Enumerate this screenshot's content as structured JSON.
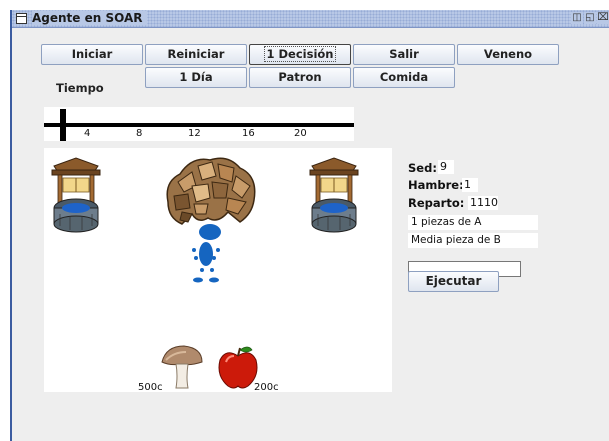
{
  "window": {
    "title": "Agente en SOAR",
    "controls": [
      "restore-icon",
      "maximize-icon",
      "close-icon"
    ]
  },
  "toolbar": {
    "row1": [
      "Iniciar",
      "Reiniciar",
      "1 Decisión",
      "Salir",
      "Veneno"
    ],
    "row2": [
      "1 Día",
      "Patron",
      "Comida"
    ]
  },
  "timeline": {
    "label": "Tiempo",
    "ticks": [
      "4",
      "8",
      "12",
      "16",
      "20"
    ]
  },
  "status": {
    "sed_label": "Sed:",
    "sed_value": "9",
    "hambre_label": "Hambre:",
    "hambre_value": "1",
    "reparto_label": "Reparto:",
    "reparto_value": "1110",
    "line1": "1 piezas de A",
    "line2": "Media pieza de B",
    "command_value": "",
    "execute_label": "Ejecutar"
  },
  "board": {
    "mushroom_price": "500c",
    "apple_price": "200c",
    "icons": [
      "well-icon",
      "rock-pile-icon",
      "agent-figure-icon",
      "mushroom-icon",
      "apple-icon"
    ]
  },
  "colors": {
    "titlebar": "#b8c8e6",
    "window_border": "#3b5ca0",
    "agent_blue": "#1565c0",
    "apple_red": "#cc1a0a"
  }
}
